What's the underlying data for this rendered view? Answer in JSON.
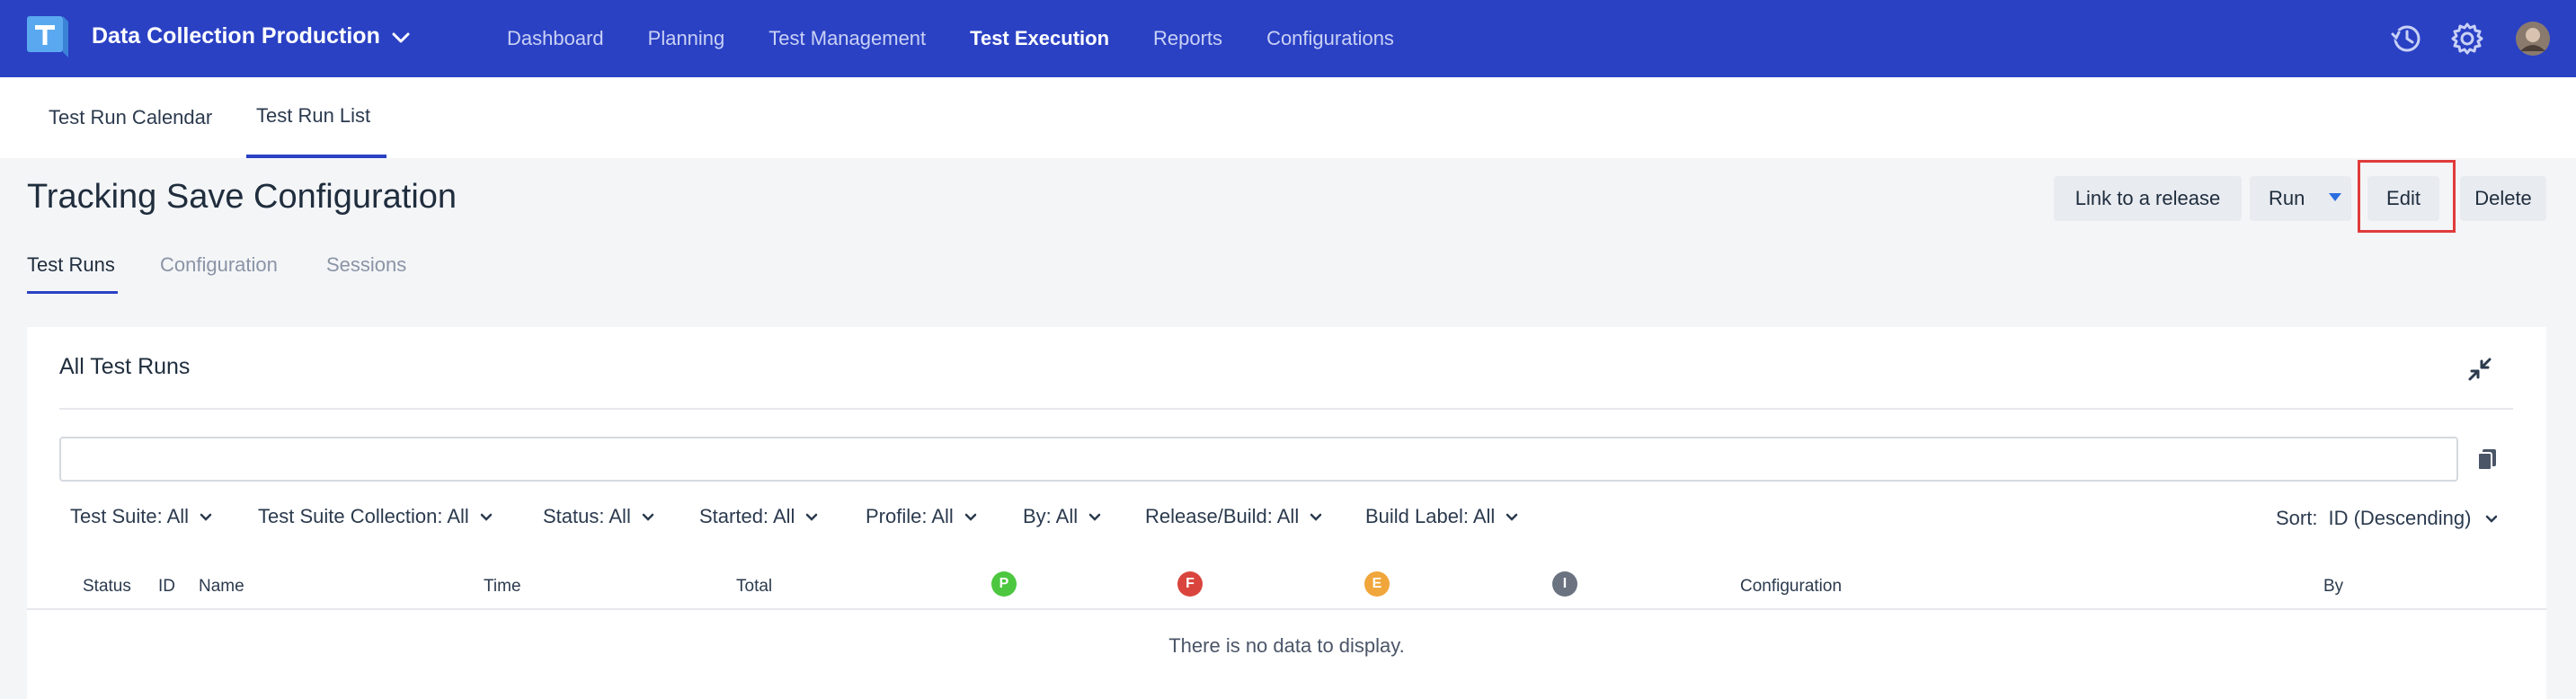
{
  "topbar": {
    "project": "Data Collection Production",
    "nav": [
      "Dashboard",
      "Planning",
      "Test Management",
      "Test Execution",
      "Reports",
      "Configurations"
    ],
    "active_nav": "Test Execution"
  },
  "subtabs": [
    "Test Run Calendar",
    "Test Run List"
  ],
  "page": {
    "title": "Tracking Save Configuration",
    "buttons": {
      "link_release": "Link to a release",
      "run": "Run",
      "edit": "Edit",
      "delete": "Delete"
    },
    "tabs": [
      "Test Runs",
      "Configuration",
      "Sessions"
    ]
  },
  "card": {
    "title": "All Test Runs",
    "search_value": "",
    "filters": [
      "Test Suite: All",
      "Test Suite Collection: All",
      "Status: All",
      "Started: All",
      "Profile: All",
      "By: All",
      "Release/Build: All",
      "Build Label: All"
    ],
    "sort_label": "Sort:",
    "sort_value": "ID (Descending)",
    "columns": [
      "Status",
      "ID",
      "Name",
      "Time",
      "Total",
      "Configuration",
      "By"
    ],
    "status_badges": [
      {
        "letter": "P",
        "color": "#4cc73f"
      },
      {
        "letter": "F",
        "color": "#d9453d"
      },
      {
        "letter": "E",
        "color": "#f0a63a"
      },
      {
        "letter": "I",
        "color": "#6b7280"
      }
    ],
    "empty_text": "There is no data to display."
  },
  "colors": {
    "brand": "#2a41c4",
    "highlight": "#e03b3b"
  }
}
